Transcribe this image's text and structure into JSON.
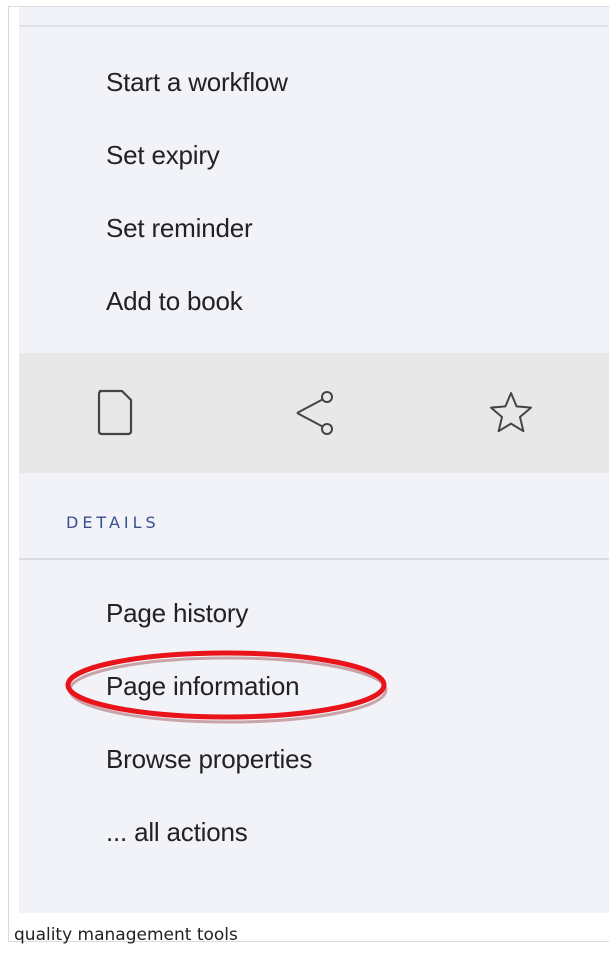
{
  "menu": {
    "start_workflow": "Start a workflow",
    "set_expiry": "Set expiry",
    "set_reminder": "Set reminder",
    "add_to_book": "Add to book"
  },
  "toolbar": {
    "icons": [
      "page-icon",
      "share-icon",
      "star-icon"
    ],
    "background": "#e8e8e8"
  },
  "details": {
    "heading": "DETAILS",
    "page_history": "Page history",
    "page_information": "Page information",
    "browse_properties": "Browse properties",
    "all_actions": "... all actions"
  },
  "highlight_color": "#e8141a",
  "caption": "quality management tools"
}
